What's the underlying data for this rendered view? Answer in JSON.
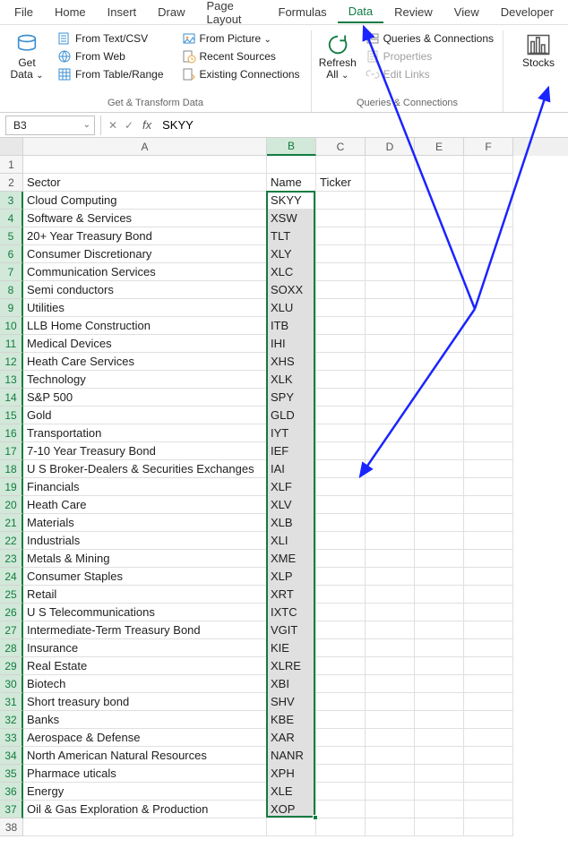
{
  "menu": {
    "items": [
      "File",
      "Home",
      "Insert",
      "Draw",
      "Page Layout",
      "Formulas",
      "Data",
      "Review",
      "View",
      "Developer"
    ],
    "active_index": 6
  },
  "ribbon": {
    "get_data": {
      "big_label_line1": "Get",
      "big_label_line2": "Data",
      "group_label": "Get & Transform Data",
      "from_text_csv": "From Text/CSV",
      "from_web": "From Web",
      "from_table_range": "From Table/Range",
      "from_picture": "From Picture",
      "recent_sources": "Recent Sources",
      "existing_connections": "Existing Connections"
    },
    "queries": {
      "big_label_line1": "Refresh",
      "big_label_line2": "All",
      "group_label": "Queries & Connections",
      "queries_connections": "Queries & Connections",
      "properties": "Properties",
      "edit_links": "Edit Links"
    },
    "stocks": {
      "label": "Stocks"
    }
  },
  "formula_bar": {
    "name_box": "B3",
    "fx_label": "fx",
    "value": "SKYY"
  },
  "columns": [
    "A",
    "B",
    "C",
    "D",
    "E",
    "F"
  ],
  "headers": {
    "A": "Sector",
    "B": "Name",
    "C": "Ticker"
  },
  "rows": [
    {
      "n": 2,
      "A": "Sector",
      "B": "Name",
      "C": "Ticker"
    },
    {
      "n": 3,
      "A": "Cloud Computing",
      "B": "SKYY"
    },
    {
      "n": 4,
      "A": "Software & Services",
      "B": "XSW"
    },
    {
      "n": 5,
      "A": "20+ Year Treasury Bond",
      "B": "TLT"
    },
    {
      "n": 6,
      "A": "Consumer Discretionary",
      "B": "XLY"
    },
    {
      "n": 7,
      "A": "Communication Services",
      "B": "XLC"
    },
    {
      "n": 8,
      "A": "Semi conductors",
      "B": "SOXX"
    },
    {
      "n": 9,
      "A": "Utilities",
      "B": "XLU"
    },
    {
      "n": 10,
      "A": "LLB Home Construction",
      "B": "ITB"
    },
    {
      "n": 11,
      "A": "Medical Devices",
      "B": "IHI"
    },
    {
      "n": 12,
      "A": "Heath Care Services",
      "B": "XHS"
    },
    {
      "n": 13,
      "A": "Technology",
      "B": "XLK"
    },
    {
      "n": 14,
      "A": "S&P 500",
      "B": "SPY"
    },
    {
      "n": 15,
      "A": "Gold",
      "B": "GLD"
    },
    {
      "n": 16,
      "A": "Transportation",
      "B": "IYT"
    },
    {
      "n": 17,
      "A": "7-10 Year Treasury Bond",
      "B": "IEF"
    },
    {
      "n": 18,
      "A": "U S Broker-Dealers & Securities Exchanges",
      "B": "IAI"
    },
    {
      "n": 19,
      "A": "Financials",
      "B": "XLF"
    },
    {
      "n": 20,
      "A": "Heath Care",
      "B": "XLV"
    },
    {
      "n": 21,
      "A": "Materials",
      "B": "XLB"
    },
    {
      "n": 22,
      "A": "Industrials",
      "B": "XLI"
    },
    {
      "n": 23,
      "A": "Metals & Mining",
      "B": "XME"
    },
    {
      "n": 24,
      "A": "Consumer Staples",
      "B": "XLP"
    },
    {
      "n": 25,
      "A": "Retail",
      "B": "XRT"
    },
    {
      "n": 26,
      "A": "U S Telecommunications",
      "B": "IXTC"
    },
    {
      "n": 27,
      "A": "Intermediate-Term Treasury Bond",
      "B": "VGIT"
    },
    {
      "n": 28,
      "A": "Insurance",
      "B": "KIE"
    },
    {
      "n": 29,
      "A": "Real Estate",
      "B": "XLRE"
    },
    {
      "n": 30,
      "A": "Biotech",
      "B": "XBI"
    },
    {
      "n": 31,
      "A": "Short treasury bond",
      "B": "SHV"
    },
    {
      "n": 32,
      "A": "Banks",
      "B": "KBE"
    },
    {
      "n": 33,
      "A": "Aerospace & Defense",
      "B": "XAR"
    },
    {
      "n": 34,
      "A": "North American Natural Resources",
      "B": "NANR"
    },
    {
      "n": 35,
      "A": "Pharmace uticals",
      "B": "XPH"
    },
    {
      "n": 36,
      "A": "Energy",
      "B": "XLE"
    },
    {
      "n": 37,
      "A": "Oil & Gas Exploration & Production",
      "B": "XOP"
    }
  ],
  "selection": {
    "col": "B",
    "row_start": 3,
    "row_end": 37,
    "active_cell": "B3"
  }
}
